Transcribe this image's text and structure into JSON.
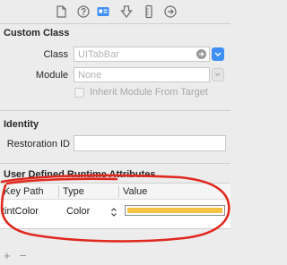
{
  "toolbar": {
    "icons": [
      "file-inspector-icon",
      "quick-help-icon",
      "identity-inspector-icon",
      "attributes-inspector-icon",
      "size-inspector-icon",
      "connections-inspector-icon"
    ]
  },
  "custom_class": {
    "title": "Custom Class",
    "class_label": "Class",
    "class_placeholder": "UITabBar",
    "module_label": "Module",
    "module_placeholder": "None",
    "inherit_label": "Inherit Module From Target"
  },
  "identity": {
    "title": "Identity",
    "restoration_id_label": "Restoration ID",
    "restoration_id_value": ""
  },
  "runtime_attributes": {
    "title": "User Defined Runtime Attributes",
    "columns": [
      "Key Path",
      "Type",
      "Value"
    ],
    "rows": [
      {
        "key_path": "tintColor",
        "type": "Color",
        "value_color": "#f5c242"
      }
    ]
  },
  "footer": {
    "add_label": "+",
    "remove_label": "−"
  },
  "colors": {
    "accent": "#3d8ef5",
    "annotation": "#e0281e"
  }
}
